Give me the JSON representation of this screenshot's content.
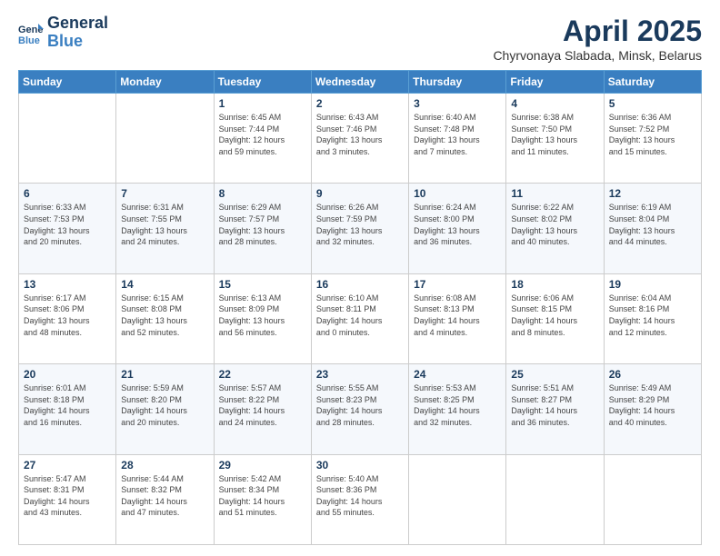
{
  "header": {
    "logo_line1": "General",
    "logo_line2": "Blue",
    "main_title": "April 2025",
    "subtitle": "Chyrvonaya Slabada, Minsk, Belarus"
  },
  "days_of_week": [
    "Sunday",
    "Monday",
    "Tuesday",
    "Wednesday",
    "Thursday",
    "Friday",
    "Saturday"
  ],
  "weeks": [
    [
      {
        "day": "",
        "info": ""
      },
      {
        "day": "",
        "info": ""
      },
      {
        "day": "1",
        "info": "Sunrise: 6:45 AM\nSunset: 7:44 PM\nDaylight: 12 hours\nand 59 minutes."
      },
      {
        "day": "2",
        "info": "Sunrise: 6:43 AM\nSunset: 7:46 PM\nDaylight: 13 hours\nand 3 minutes."
      },
      {
        "day": "3",
        "info": "Sunrise: 6:40 AM\nSunset: 7:48 PM\nDaylight: 13 hours\nand 7 minutes."
      },
      {
        "day": "4",
        "info": "Sunrise: 6:38 AM\nSunset: 7:50 PM\nDaylight: 13 hours\nand 11 minutes."
      },
      {
        "day": "5",
        "info": "Sunrise: 6:36 AM\nSunset: 7:52 PM\nDaylight: 13 hours\nand 15 minutes."
      }
    ],
    [
      {
        "day": "6",
        "info": "Sunrise: 6:33 AM\nSunset: 7:53 PM\nDaylight: 13 hours\nand 20 minutes."
      },
      {
        "day": "7",
        "info": "Sunrise: 6:31 AM\nSunset: 7:55 PM\nDaylight: 13 hours\nand 24 minutes."
      },
      {
        "day": "8",
        "info": "Sunrise: 6:29 AM\nSunset: 7:57 PM\nDaylight: 13 hours\nand 28 minutes."
      },
      {
        "day": "9",
        "info": "Sunrise: 6:26 AM\nSunset: 7:59 PM\nDaylight: 13 hours\nand 32 minutes."
      },
      {
        "day": "10",
        "info": "Sunrise: 6:24 AM\nSunset: 8:00 PM\nDaylight: 13 hours\nand 36 minutes."
      },
      {
        "day": "11",
        "info": "Sunrise: 6:22 AM\nSunset: 8:02 PM\nDaylight: 13 hours\nand 40 minutes."
      },
      {
        "day": "12",
        "info": "Sunrise: 6:19 AM\nSunset: 8:04 PM\nDaylight: 13 hours\nand 44 minutes."
      }
    ],
    [
      {
        "day": "13",
        "info": "Sunrise: 6:17 AM\nSunset: 8:06 PM\nDaylight: 13 hours\nand 48 minutes."
      },
      {
        "day": "14",
        "info": "Sunrise: 6:15 AM\nSunset: 8:08 PM\nDaylight: 13 hours\nand 52 minutes."
      },
      {
        "day": "15",
        "info": "Sunrise: 6:13 AM\nSunset: 8:09 PM\nDaylight: 13 hours\nand 56 minutes."
      },
      {
        "day": "16",
        "info": "Sunrise: 6:10 AM\nSunset: 8:11 PM\nDaylight: 14 hours\nand 0 minutes."
      },
      {
        "day": "17",
        "info": "Sunrise: 6:08 AM\nSunset: 8:13 PM\nDaylight: 14 hours\nand 4 minutes."
      },
      {
        "day": "18",
        "info": "Sunrise: 6:06 AM\nSunset: 8:15 PM\nDaylight: 14 hours\nand 8 minutes."
      },
      {
        "day": "19",
        "info": "Sunrise: 6:04 AM\nSunset: 8:16 PM\nDaylight: 14 hours\nand 12 minutes."
      }
    ],
    [
      {
        "day": "20",
        "info": "Sunrise: 6:01 AM\nSunset: 8:18 PM\nDaylight: 14 hours\nand 16 minutes."
      },
      {
        "day": "21",
        "info": "Sunrise: 5:59 AM\nSunset: 8:20 PM\nDaylight: 14 hours\nand 20 minutes."
      },
      {
        "day": "22",
        "info": "Sunrise: 5:57 AM\nSunset: 8:22 PM\nDaylight: 14 hours\nand 24 minutes."
      },
      {
        "day": "23",
        "info": "Sunrise: 5:55 AM\nSunset: 8:23 PM\nDaylight: 14 hours\nand 28 minutes."
      },
      {
        "day": "24",
        "info": "Sunrise: 5:53 AM\nSunset: 8:25 PM\nDaylight: 14 hours\nand 32 minutes."
      },
      {
        "day": "25",
        "info": "Sunrise: 5:51 AM\nSunset: 8:27 PM\nDaylight: 14 hours\nand 36 minutes."
      },
      {
        "day": "26",
        "info": "Sunrise: 5:49 AM\nSunset: 8:29 PM\nDaylight: 14 hours\nand 40 minutes."
      }
    ],
    [
      {
        "day": "27",
        "info": "Sunrise: 5:47 AM\nSunset: 8:31 PM\nDaylight: 14 hours\nand 43 minutes."
      },
      {
        "day": "28",
        "info": "Sunrise: 5:44 AM\nSunset: 8:32 PM\nDaylight: 14 hours\nand 47 minutes."
      },
      {
        "day": "29",
        "info": "Sunrise: 5:42 AM\nSunset: 8:34 PM\nDaylight: 14 hours\nand 51 minutes."
      },
      {
        "day": "30",
        "info": "Sunrise: 5:40 AM\nSunset: 8:36 PM\nDaylight: 14 hours\nand 55 minutes."
      },
      {
        "day": "",
        "info": ""
      },
      {
        "day": "",
        "info": ""
      },
      {
        "day": "",
        "info": ""
      }
    ]
  ]
}
